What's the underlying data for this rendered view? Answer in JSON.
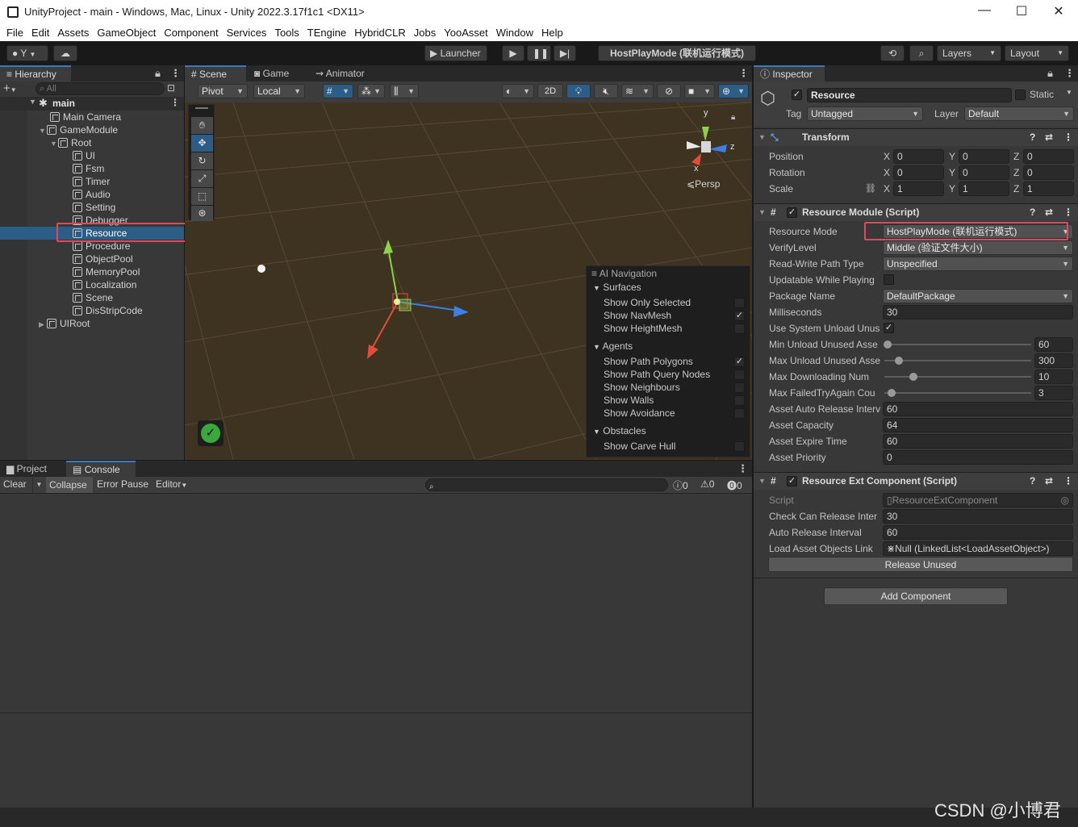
{
  "window": {
    "title": "UnityProject - main - Windows, Mac, Linux - Unity 2022.3.17f1c1 <DX11>",
    "controls": {
      "minimize": "—",
      "maximize": "☐",
      "close": "✕"
    }
  },
  "menu": [
    "File",
    "Edit",
    "Assets",
    "GameObject",
    "Component",
    "Services",
    "Tools",
    "TEngine",
    "HybridCLR",
    "Jobs",
    "YooAsset",
    "Window",
    "Help"
  ],
  "toolbar": {
    "account": "Y",
    "launcher": "Launcher",
    "play_mode_label": "HostPlayMode (联机运行模式)",
    "layers": "Layers",
    "layout": "Layout"
  },
  "hierarchy": {
    "tab": "Hierarchy",
    "search_placeholder": "All",
    "scene_name": "main",
    "items": [
      {
        "label": "Main Camera"
      },
      {
        "label": "GameModule"
      },
      {
        "label": "Root"
      },
      {
        "label": "UI"
      },
      {
        "label": "Fsm"
      },
      {
        "label": "Timer"
      },
      {
        "label": "Audio"
      },
      {
        "label": "Setting"
      },
      {
        "label": "Debugger"
      },
      {
        "label": "Resource"
      },
      {
        "label": "Procedure"
      },
      {
        "label": "ObjectPool"
      },
      {
        "label": "MemoryPool"
      },
      {
        "label": "Localization"
      },
      {
        "label": "Scene"
      },
      {
        "label": "DisStripCode"
      },
      {
        "label": "UIRoot"
      }
    ]
  },
  "scene_tabs": {
    "scene": "Scene",
    "game": "Game",
    "animator": "Animator"
  },
  "scene_toolbar": {
    "pivot": "Pivot",
    "local": "Local",
    "mode_2d": "2D"
  },
  "scene": {
    "persp_label": "Persp",
    "gizmo_y": "y",
    "gizmo_x": "x",
    "gizmo_z": "z"
  },
  "ai_navigation": {
    "title": "AI Navigation",
    "surfaces": {
      "heading": "Surfaces",
      "items": [
        {
          "label": "Show Only Selected",
          "checked": false
        },
        {
          "label": "Show NavMesh",
          "checked": true
        },
        {
          "label": "Show HeightMesh",
          "checked": false
        }
      ]
    },
    "agents": {
      "heading": "Agents",
      "items": [
        {
          "label": "Show Path Polygons",
          "checked": true
        },
        {
          "label": "Show Path Query Nodes",
          "checked": false
        },
        {
          "label": "Show Neighbours",
          "checked": false
        },
        {
          "label": "Show Walls",
          "checked": false
        },
        {
          "label": "Show Avoidance",
          "checked": false
        }
      ]
    },
    "obstacles": {
      "heading": "Obstacles",
      "items": [
        {
          "label": "Show Carve Hull",
          "checked": false
        }
      ]
    }
  },
  "bottom_tabs": {
    "project": "Project",
    "console": "Console"
  },
  "console": {
    "clear": "Clear",
    "collapse": "Collapse",
    "error_pause": "Error Pause",
    "editor": "Editor",
    "info_count": "0",
    "warn_count": "0",
    "error_count": "0"
  },
  "inspector": {
    "tab": "Inspector",
    "object_name": "Resource",
    "static_label": "Static",
    "tag_label": "Tag",
    "tag_value": "Untagged",
    "layer_label": "Layer",
    "layer_value": "Default",
    "transform": {
      "title": "Transform",
      "position": {
        "label": "Position",
        "x": "0",
        "y": "0",
        "z": "0"
      },
      "rotation": {
        "label": "Rotation",
        "x": "0",
        "y": "0",
        "z": "0"
      },
      "scale": {
        "label": "Scale",
        "x": "1",
        "y": "1",
        "z": "1"
      }
    },
    "resource_module": {
      "title": "Resource Module (Script)",
      "resource_mode_label": "Resource Mode",
      "resource_mode_value": "HostPlayMode (联机运行模式)",
      "verify_level_label": "VerifyLevel",
      "verify_level_value": "Middle (验证文件大小)",
      "rw_path_label": "Read-Write Path Type",
      "rw_path_value": "Unspecified",
      "update_while_playing_label": "Updatable While Playing",
      "package_name_label": "Package Name",
      "package_name_value": "DefaultPackage",
      "milliseconds_label": "Milliseconds",
      "milliseconds_value": "30",
      "use_system_unload_label": "Use System Unload Unus",
      "min_unload_label": "Min Unload Unused Asse",
      "min_unload_value": "60",
      "min_unload_fraction": 0.02,
      "max_unload_label": "Max Unload Unused Asse",
      "max_unload_value": "300",
      "max_unload_fraction": 0.1,
      "max_downloading_label": "Max Downloading Num",
      "max_downloading_value": "10",
      "max_downloading_fraction": 0.2,
      "max_failed_label": "Max FailedTryAgain Cou",
      "max_failed_value": "3",
      "max_failed_fraction": 0.05,
      "auto_release_label": "Asset Auto Release Interv",
      "auto_release_value": "60",
      "capacity_label": "Asset Capacity",
      "capacity_value": "64",
      "expire_label": "Asset Expire Time",
      "expire_value": "60",
      "priority_label": "Asset Priority",
      "priority_value": "0"
    },
    "resource_ext": {
      "title": "Resource Ext Component (Script)",
      "script_label": "Script",
      "script_value": "ResourceExtComponent",
      "check_release_label": "Check Can Release Inter",
      "check_release_value": "30",
      "auto_release_label": "Auto Release Interval",
      "auto_release_value": "60",
      "load_asset_label": "Load Asset Objects Link",
      "load_asset_value": "Null (LinkedList<LoadAssetObject>)",
      "release_unused_button": "Release Unused"
    },
    "add_component_button": "Add Component"
  },
  "watermark": "CSDN @小博君",
  "colors": {
    "accent": "#3a79bb",
    "highlight": "#e2475c",
    "selection": "#2c5d87"
  }
}
